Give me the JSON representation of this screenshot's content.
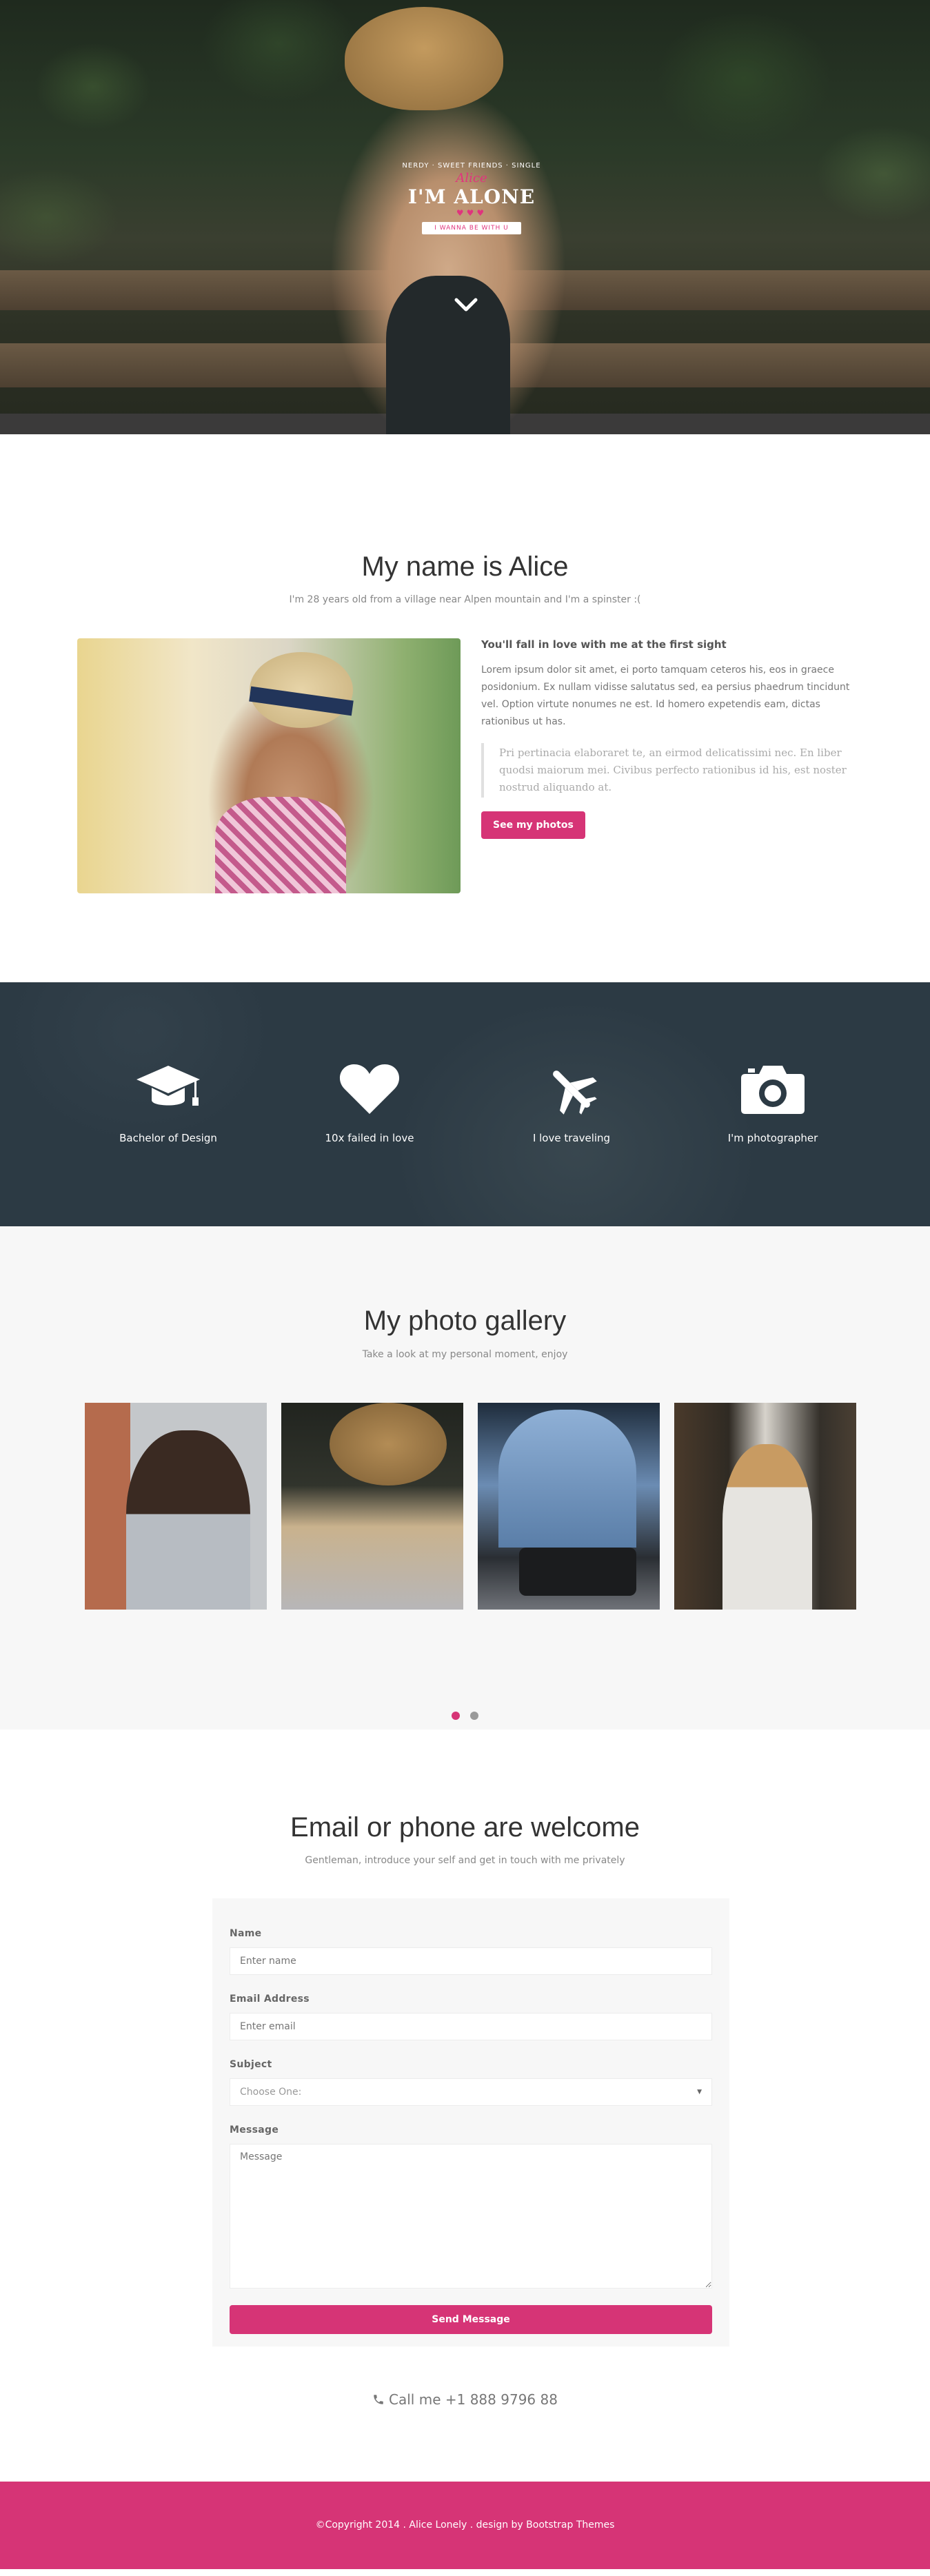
{
  "hero": {
    "badge_arc": "NERDY · SWEET FRIENDS · SINGLE",
    "badge_name": "Alice",
    "badge_title": "I'M ALONE",
    "badge_hearts": "♥♥♥",
    "badge_ribbon": "I WANNA BE WITH U"
  },
  "about": {
    "title": "My name is Alice",
    "subtitle": "I'm 28 years old from a village near Alpen mountain and I'm a spinster :(",
    "lead": "You'll fall in love with me at the first sight",
    "paragraph": "Lorem ipsum dolor sit amet, ei porto tamquam ceteros his, eos in graece posidonium. Ex nullam vidisse salutatus sed, ea persius phaedrum tincidunt vel. Option virtute nonumes ne est. Id homero expetendis eam, dictas rationibus ut has.",
    "quote": "Pri pertinacia elaboraret te, an eirmod delicatissimi nec. En liber quodsi maiorum mei. Civibus perfecto rationibus id his, est noster nostrud aliquando at.",
    "button_label": "See my photos"
  },
  "features": {
    "items": [
      {
        "icon": "graduation-cap-icon",
        "label": "Bachelor of Design"
      },
      {
        "icon": "heart-icon",
        "label": "10x failed in love"
      },
      {
        "icon": "plane-icon",
        "label": "I love traveling"
      },
      {
        "icon": "camera-icon",
        "label": "I'm photographer"
      }
    ]
  },
  "gallery": {
    "title": "My photo gallery",
    "subtitle": "Take a look at my personal moment, enjoy"
  },
  "contact": {
    "title": "Email or phone are welcome",
    "subtitle": "Gentleman, introduce your self and get in touch with me privately",
    "name_label": "Name",
    "name_placeholder": "Enter name",
    "email_label": "Email Address",
    "email_placeholder": "Enter email",
    "subject_label": "Subject",
    "subject_value": "Choose One:",
    "message_label": "Message",
    "message_placeholder": "Message",
    "send_label": "Send Message",
    "call_text": "Call me +1 888 9796 88"
  },
  "footer": {
    "text": "©Copyright 2014 . Alice Lonely . design by Bootstrap Themes"
  },
  "colors": {
    "accent": "#d63476",
    "dark_band": "#2c3a44",
    "gallery_bg": "#f7f7f7"
  }
}
